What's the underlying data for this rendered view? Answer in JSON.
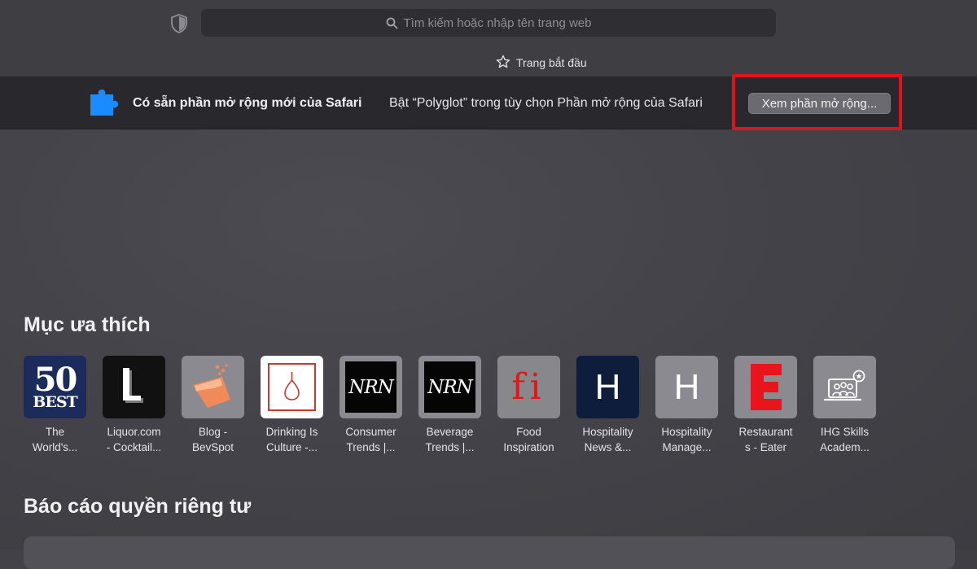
{
  "toolbar": {
    "address_placeholder": "Tìm kiếm hoặc nhập tên trang web",
    "tab_label": "Trang bắt đầu"
  },
  "banner": {
    "title": "Có sẵn phần mở rộng mới của Safari",
    "text": "Bật “Polyglot” trong tùy chọn Phần mở rộng của Safari",
    "button_label": "Xem phần mở rộng..."
  },
  "favorites": {
    "heading": "Mục ưa thích",
    "items": [
      {
        "line1": "The",
        "line2": "World's...",
        "tile_text_top": "50",
        "tile_text_bottom": "BEST"
      },
      {
        "line1": "Liquor.com",
        "line2": "- Cocktail...",
        "tile_text": "L"
      },
      {
        "line1": "Blog -",
        "line2": "BevSpot"
      },
      {
        "line1": "Drinking Is",
        "line2": "Culture -..."
      },
      {
        "line1": "Consumer",
        "line2": "Trends |...",
        "tile_text": "NRN"
      },
      {
        "line1": "Beverage",
        "line2": "Trends |...",
        "tile_text": "NRN"
      },
      {
        "line1": "Food",
        "line2": "Inspiration",
        "tile_text": "fi"
      },
      {
        "line1": "Hospitality",
        "line2": "News &...",
        "tile_text": "H"
      },
      {
        "line1": "Hospitality",
        "line2": "Manage...",
        "tile_text": "H"
      },
      {
        "line1": "Restaurant",
        "line2": "s - Eater",
        "tile_text": "E"
      },
      {
        "line1": "IHG Skills",
        "line2": "Academ..."
      }
    ]
  },
  "privacy": {
    "heading": "Báo cáo quyền riêng tư"
  },
  "colors": {
    "highlight": "#e0121c",
    "puzzle_icon": "#1a8cff"
  }
}
